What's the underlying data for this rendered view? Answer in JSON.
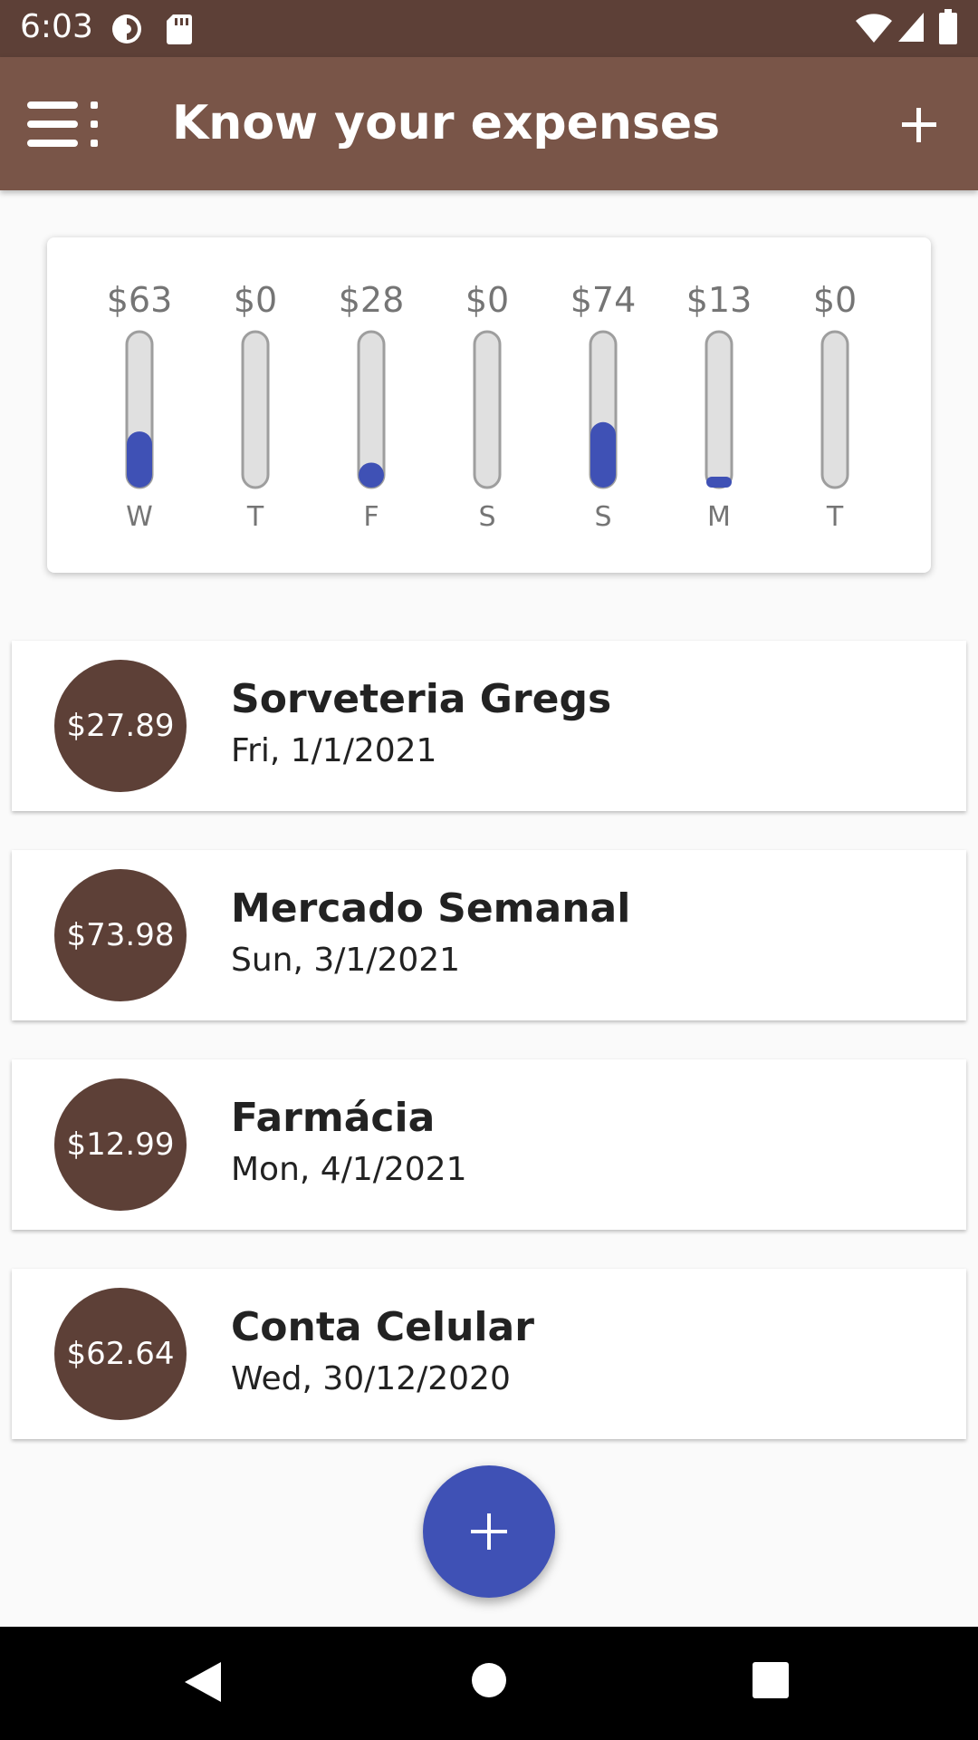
{
  "status_bar": {
    "time": "6:03",
    "icons": [
      "data-saver-icon",
      "sd-card-icon",
      "wifi-icon",
      "signal-icon",
      "battery-icon"
    ]
  },
  "app_bar": {
    "title": "Know your expenses",
    "menu_icon": "menu-icon",
    "add_icon": "plus-icon"
  },
  "colors": {
    "status_bar": "#5d4037",
    "app_bar": "#795548",
    "avatar": "#5d4037",
    "accent": "#3f51b5",
    "bar_track": "#e0e0e0"
  },
  "chart_data": {
    "type": "bar",
    "categories": [
      "W",
      "T",
      "F",
      "S",
      "S",
      "M",
      "T"
    ],
    "value_labels": [
      "$63",
      "$0",
      "$28",
      "$0",
      "$74",
      "$13",
      "$0"
    ],
    "fill_fractions": [
      0.36,
      0,
      0.16,
      0,
      0.42,
      0.07,
      0
    ]
  },
  "transactions": [
    {
      "amount": "$27.89",
      "title": "Sorveteria Gregs",
      "date": "Fri, 1/1/2021"
    },
    {
      "amount": "$73.98",
      "title": "Mercado Semanal",
      "date": "Sun, 3/1/2021"
    },
    {
      "amount": "$12.99",
      "title": "Farmácia",
      "date": "Mon, 4/1/2021"
    },
    {
      "amount": "$62.64",
      "title": "Conta Celular",
      "date": "Wed, 30/12/2020"
    }
  ],
  "fab": {
    "icon": "plus-icon"
  },
  "nav_bar": {
    "icons": [
      "back-icon",
      "home-icon",
      "recents-icon"
    ]
  }
}
